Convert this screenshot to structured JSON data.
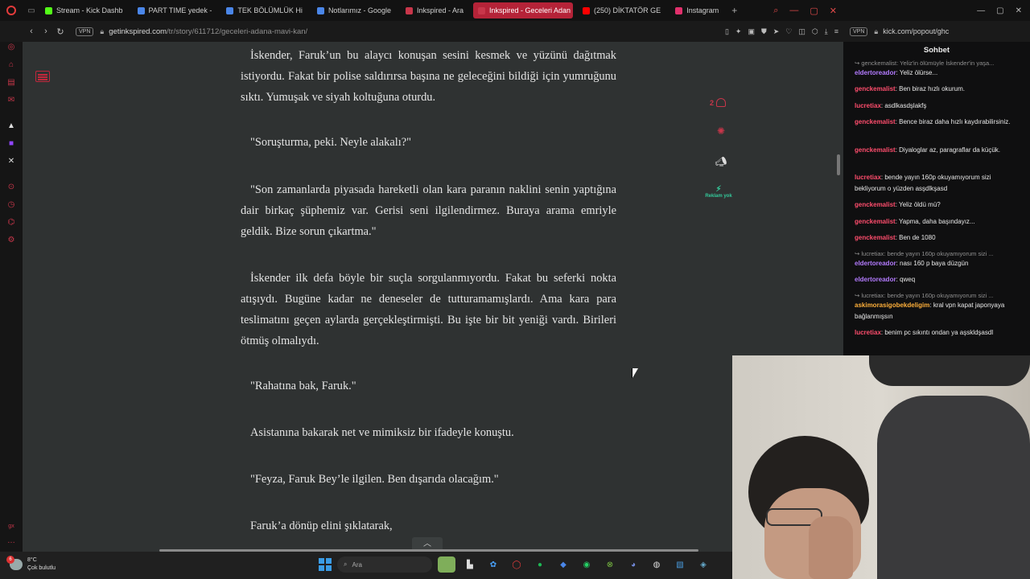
{
  "browser": {
    "tabs": [
      {
        "label": "Stream - Kick Dashb",
        "color": "#53fc18"
      },
      {
        "label": "PART TIME yedek -",
        "color": "#4a86e8"
      },
      {
        "label": "TEK BÖLÜMLÜK Hi",
        "color": "#4a86e8"
      },
      {
        "label": "Notlarımız - Google",
        "color": "#4a86e8"
      },
      {
        "label": "Inkspired - Ara",
        "color": "#c8364a"
      },
      {
        "label": "Inkspired - Geceleri Adan",
        "color": "#c8364a",
        "active": true
      },
      {
        "label": "(250) DİKTATÖR GE",
        "color": "#ff0000"
      },
      {
        "label": "Instagram",
        "color": "#e1306c"
      }
    ],
    "vpn_label": "VPN",
    "url_host": "getinkspired.com",
    "url_path": "/tr/story/611712/geceleri-adana-mavi-kan/"
  },
  "story": {
    "paragraphs": [
      {
        "text": "İskender, Faruk’un bu alaycı konuşan sesini kesmek ve yüzünü dağıtmak istiyordu. Fakat bir polise saldırırsa başına ne geleceğini bildiği için yumruğunu sıktı. Yumuşak ve siyah koltuğuna oturdu.",
        "kind": "indent"
      },
      {
        "text": "\"Soruşturma, peki. Neyle alakalı?\"",
        "kind": "dlg"
      },
      {
        "text": "\"Son zamanlarda piyasada hareketli olan kara paranın naklini senin yaptığına dair birkaç şüphemiz var. Gerisi seni ilgilendirmez. Buraya arama emriyle geldik. Bize sorun çıkartma.\"",
        "kind": "indent"
      },
      {
        "text": "İskender ilk defa böyle bir suçla sorgulanmıyordu. Fakat bu seferki nokta atışıydı. Bugüne kadar ne deneseler de tutturamamışlardı. Ama kara para teslimatını geçen aylarda gerçekleştirmişti. Bu işte bir bit yeniği vardı. Birileri ötmüş olmalıydı.",
        "kind": "indent"
      },
      {
        "text": "\"Rahatına bak, Faruk.\"",
        "kind": "dlg"
      },
      {
        "text": "Asistanına bakarak net ve mimiksiz bir ifadeyle konuştu.",
        "kind": "dlg"
      },
      {
        "text": "\"Feyza, Faruk Bey’le ilgilen. Ben dışarıda olacağım.\"",
        "kind": "dlg"
      },
      {
        "text": "Faruk’a dönüp elini şıklatarak,",
        "kind": "dlg"
      }
    ],
    "like_count": "2",
    "ad_label": "Reklam yok"
  },
  "chat": {
    "url": "kick.com/popout/ghc",
    "title": "Sohbet",
    "messages": [
      {
        "reply": "genckemalist: Yeliz'in ölümüyle İskender'in yaşa..."
      },
      {
        "user": "eldertoreador",
        "color": "#b37bff",
        "text": ": Yeliz ölürse..."
      },
      {
        "user": "genckemalist",
        "color": "#ff4d6d",
        "text": ": Ben biraz hızlı okurum."
      },
      {
        "user": "lucretiax",
        "color": "#ff4d6d",
        "text": ": asdlkasdşlakfş"
      },
      {
        "user": "genckemalist",
        "color": "#ff4d6d",
        "text": ": Bence biraz daha hızlı kaydırabilirsiniz."
      },
      {
        "user": "genckemalist",
        "color": "#ff4d6d",
        "text": ": Diyaloglar az, paragraflar da küçük."
      },
      {
        "user": "lucretiax",
        "color": "#ff4d6d",
        "text": ": bende yayın 160p okuyamıyorum sizi bekliyorum o yüzden asşdlkşasd"
      },
      {
        "user": "genckemalist",
        "color": "#ff4d6d",
        "text": ": Yeliz öldü mü?"
      },
      {
        "user": "genckemalist",
        "color": "#ff4d6d",
        "text": ": Yapma, daha başındayız..."
      },
      {
        "user": "genckemalist",
        "color": "#ff4d6d",
        "text": ": Ben de 1080"
      },
      {
        "reply": "lucretiax: bende yayın 160p okuyamıyorum sizi ..."
      },
      {
        "user": "eldertoreador",
        "color": "#b37bff",
        "text": ": nası 160 p baya düzgün"
      },
      {
        "user": "eldertoreador",
        "color": "#b37bff",
        "text": ": qweq"
      },
      {
        "reply": "lucretiax: bende yayın 160p okuyamıyorum sizi ..."
      },
      {
        "user": "askimorasigobekdeligim",
        "color": "#ffb03a",
        "text": ": kral vpn kapat japonyaya bağlanmışsın"
      },
      {
        "user": "lucretiax",
        "color": "#ff4d6d",
        "text": ": benim pc sıkıntı ondan ya aşskldşasdl"
      }
    ]
  },
  "taskbar": {
    "weather_temp": "8°C",
    "weather_desc": "Çok bulutlu",
    "weather_badge": "6",
    "search_placeholder": "Ara"
  }
}
